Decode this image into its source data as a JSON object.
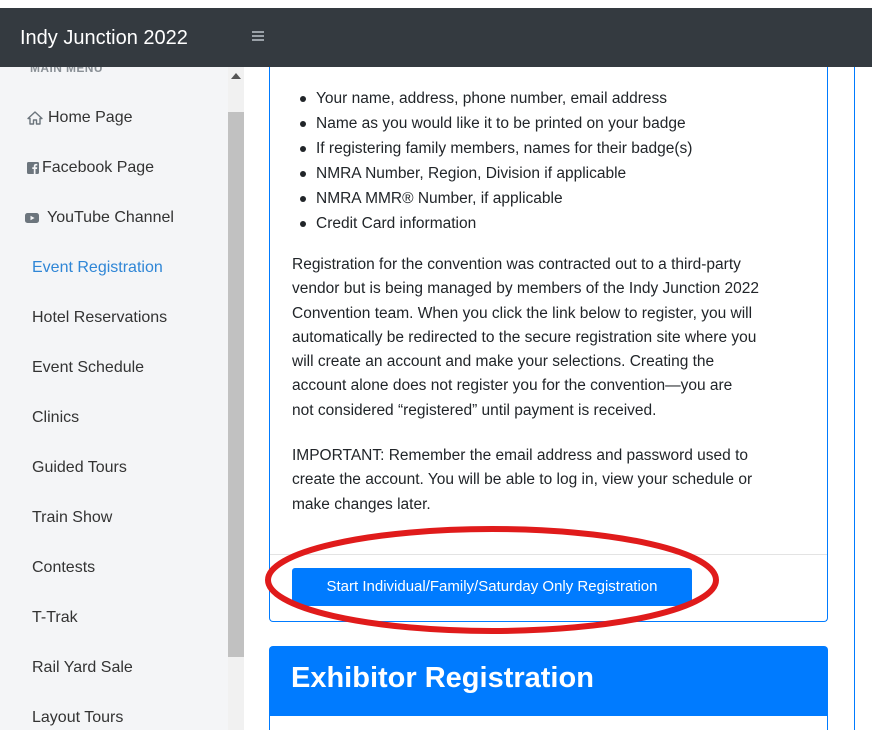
{
  "app": {
    "brand": "Indy Junction 2022"
  },
  "sidebar": {
    "header": "MAIN MENU",
    "items": [
      {
        "label": "Home Page",
        "icon": "home-icon"
      },
      {
        "label": "Facebook Page",
        "icon": "facebook-icon"
      },
      {
        "label": "YouTube Channel",
        "icon": "youtube-icon"
      },
      {
        "label": "Event Registration",
        "active": true
      },
      {
        "label": "Hotel Reservations"
      },
      {
        "label": "Event Schedule"
      },
      {
        "label": "Clinics"
      },
      {
        "label": "Guided Tours"
      },
      {
        "label": "Train Show"
      },
      {
        "label": "Contests"
      },
      {
        "label": "T-Trak"
      },
      {
        "label": "Rail Yard Sale"
      },
      {
        "label": "Layout Tours"
      }
    ]
  },
  "main": {
    "requirements": [
      "Your name, address, phone number, email address",
      "Name as you would like it to be printed on your badge",
      "If registering family members, names for their badge(s)",
      "NMRA Number, Region, Division if applicable",
      "NMRA MMR® Number, if applicable",
      "Credit Card information"
    ],
    "paragraph1": [
      "Registration for the convention was contracted out to a third-party",
      "vendor but is being managed by members of the Indy Junction 2022",
      "Convention team. When you click the link below to register, you will",
      "automatically be redirected to the secure registration site where you",
      "will create an account and make your selections. Creating the",
      "account alone does not register you for the convention—you are",
      "not considered “registered” until payment is received."
    ],
    "paragraph2": [
      "IMPORTANT: Remember the email address and password used to",
      "create the account. You will be able to log in, view your schedule or",
      "make changes later."
    ],
    "register_button": "Start Individual/Family/Saturday Only Registration",
    "exhibitor_title": "Exhibitor Registration"
  },
  "colors": {
    "topbar": "#343a40",
    "primary": "#007bff",
    "active_link": "#2f86d6",
    "highlight": "#e01b1b"
  }
}
